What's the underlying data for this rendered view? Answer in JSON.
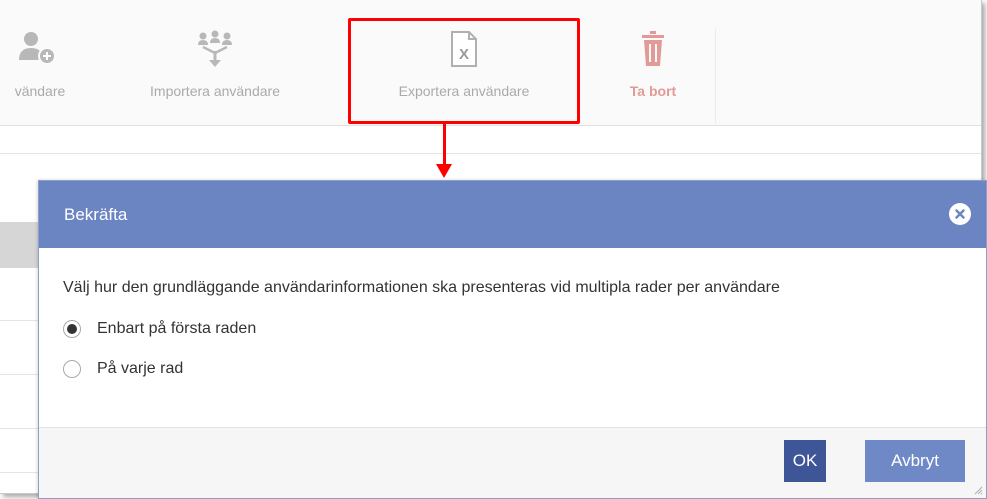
{
  "toolbar": {
    "buttons": [
      {
        "label": "vändare",
        "icon": "add-user-icon"
      },
      {
        "label": "Importera användare",
        "icon": "import-users-icon"
      },
      {
        "label": "Exportera användare",
        "icon": "excel-export-icon"
      },
      {
        "label": "Ta bort",
        "icon": "trash-icon"
      }
    ]
  },
  "dialog": {
    "title": "Bekräfta",
    "question": "Välj hur den grundläggande användarinformationen ska presenteras vid multipla rader per användare",
    "options": [
      {
        "label": "Enbart på första raden",
        "selected": true
      },
      {
        "label": "På varje rad",
        "selected": false
      }
    ],
    "ok_label": "OK",
    "cancel_label": "Avbryt"
  },
  "colors": {
    "header": "#6a85c1",
    "ok_button": "#3e5598",
    "cancel_button": "#6f89c6",
    "highlight": "#ff0000",
    "delete": "#e29a96"
  }
}
